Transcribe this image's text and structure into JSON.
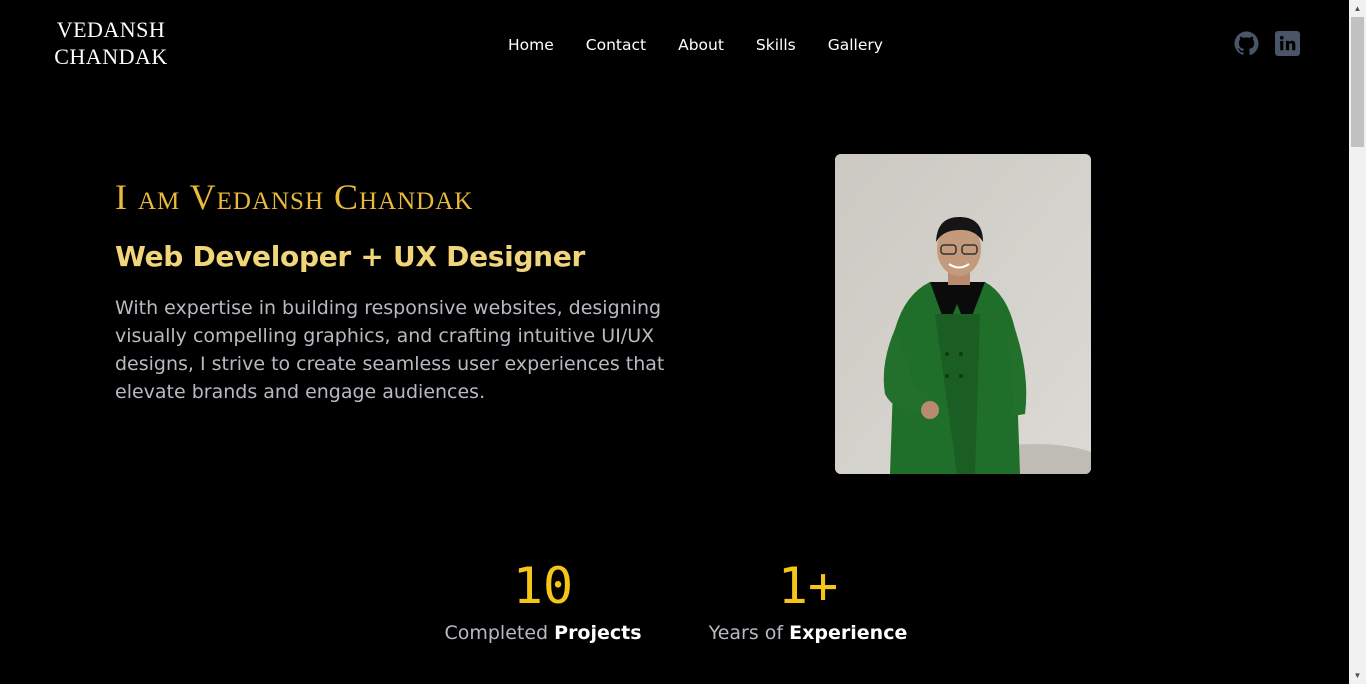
{
  "brand": {
    "line1": "VEDANSH",
    "line2": "CHANDAK"
  },
  "nav": [
    {
      "label": "Home"
    },
    {
      "label": "Contact"
    },
    {
      "label": "About"
    },
    {
      "label": "Skills"
    },
    {
      "label": "Gallery"
    }
  ],
  "social": [
    {
      "icon": "github-icon"
    },
    {
      "icon": "linkedin-icon"
    }
  ],
  "hero": {
    "title": "I am Vedansh Chandak",
    "subtitle": "Web Developer + UX Designer",
    "description": "With expertise in building responsive websites, designing visually compelling graphics, and crafting intuitive UI/UX designs, I strive to create seamless user experiences that elevate brands and engage audiences."
  },
  "stats": [
    {
      "value": "10",
      "label_light": "Completed",
      "label_bold": "Projects"
    },
    {
      "value": "1+",
      "label_light": "Years of",
      "label_bold": "Experience"
    }
  ],
  "colors": {
    "background": "#000000",
    "accent_gold": "#e8b93a",
    "subtitle_gold": "#f1d57a",
    "stat_yellow": "#f5c518",
    "icon_gray": "#4a5568"
  }
}
